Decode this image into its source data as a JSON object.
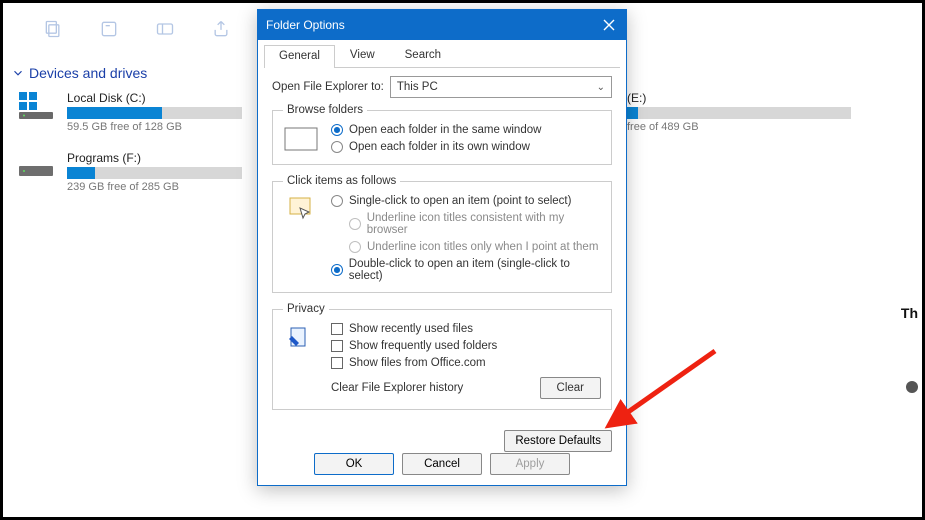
{
  "toolbar": [
    "copy-icon",
    "select-all-icon",
    "rename-icon",
    "share-icon",
    "delete-icon"
  ],
  "section_title": "Devices and drives",
  "drives": [
    {
      "id": "c",
      "name": "Local Disk (C:)",
      "free": "59.5 GB free of 128 GB",
      "fill_pct": 54
    },
    {
      "id": "f",
      "name": "Programs (F:)",
      "free": "239 GB free of 285 GB",
      "fill_pct": 16
    },
    {
      "id": "e",
      "name": "(E:)",
      "free": "free of 489 GB",
      "fill_pct": 5
    }
  ],
  "dialog": {
    "title": "Folder Options",
    "tabs": [
      "General",
      "View",
      "Search"
    ],
    "active_tab": 0,
    "open_in_label": "Open File Explorer to:",
    "open_in_value": "This PC",
    "browse_legend": "Browse folders",
    "browse_same": "Open each folder in the same window",
    "browse_own": "Open each folder in its own window",
    "click_legend": "Click items as follows",
    "click_single": "Single-click to open an item (point to select)",
    "click_u1": "Underline icon titles consistent with my browser",
    "click_u2": "Underline icon titles only when I point at them",
    "click_double": "Double-click to open an item (single-click to select)",
    "privacy_legend": "Privacy",
    "priv_recent": "Show recently used files",
    "priv_freq": "Show frequently used folders",
    "priv_office": "Show files from Office.com",
    "clear_history_label": "Clear File Explorer history",
    "clear_btn": "Clear",
    "restore_btn": "Restore Defaults",
    "ok": "OK",
    "cancel": "Cancel",
    "apply": "Apply"
  },
  "right_fragment": "Th"
}
